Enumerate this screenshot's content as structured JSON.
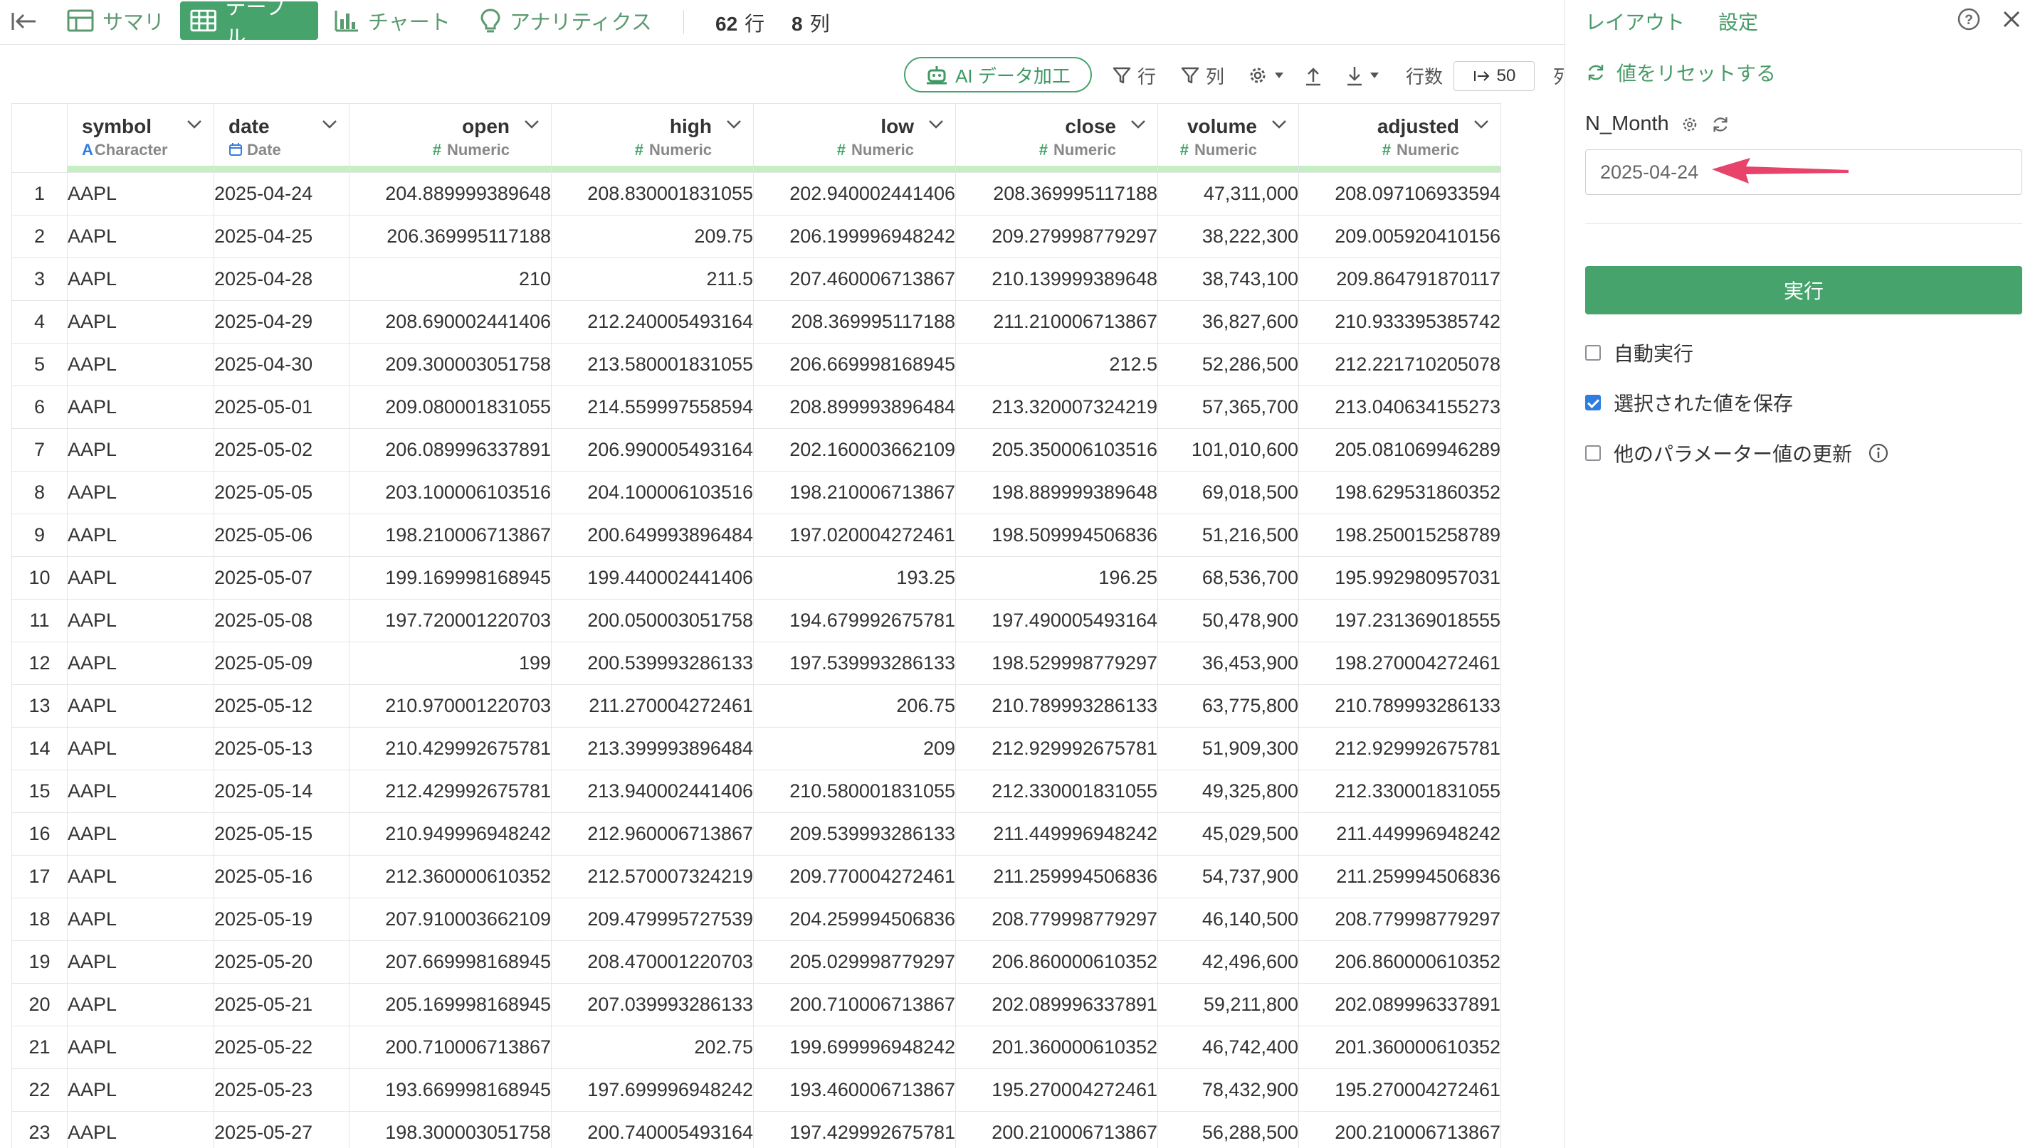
{
  "topbar": {
    "tabs": [
      {
        "label": "サマリ",
        "icon": "summary-grid-icon"
      },
      {
        "label": "テーブル",
        "icon": "table-icon",
        "active": true
      },
      {
        "label": "チャート",
        "icon": "bar-chart-icon"
      },
      {
        "label": "アナリティクス",
        "icon": "lightbulb-icon"
      }
    ],
    "rows_count": "62",
    "rows_unit": "行",
    "cols_count": "8",
    "cols_unit": "列"
  },
  "toolbar": {
    "ai_label": "AI データ加工",
    "filter_rows": "行",
    "filter_cols": "列",
    "rows_label": "行数",
    "rows_value": "50",
    "cut_label": "列"
  },
  "table": {
    "columns": [
      {
        "name": "symbol",
        "type": "Character",
        "type_icon": "A",
        "align": "l"
      },
      {
        "name": "date",
        "type": "Date",
        "type_icon": "calendar",
        "align": "l"
      },
      {
        "name": "open",
        "type": "Numeric",
        "type_icon": "#",
        "align": "r"
      },
      {
        "name": "high",
        "type": "Numeric",
        "type_icon": "#",
        "align": "r"
      },
      {
        "name": "low",
        "type": "Numeric",
        "type_icon": "#",
        "align": "r"
      },
      {
        "name": "close",
        "type": "Numeric",
        "type_icon": "#",
        "align": "r"
      },
      {
        "name": "volume",
        "type": "Numeric",
        "type_icon": "#",
        "align": "r"
      },
      {
        "name": "adjusted",
        "type": "Numeric",
        "type_icon": "#",
        "align": "r"
      }
    ],
    "rows": [
      [
        "1",
        "AAPL",
        "2025-04-24",
        "204.889999389648",
        "208.830001831055",
        "202.940002441406",
        "208.369995117188",
        "47,311,000",
        "208.097106933594"
      ],
      [
        "2",
        "AAPL",
        "2025-04-25",
        "206.369995117188",
        "209.75",
        "206.199996948242",
        "209.279998779297",
        "38,222,300",
        "209.005920410156"
      ],
      [
        "3",
        "AAPL",
        "2025-04-28",
        "210",
        "211.5",
        "207.460006713867",
        "210.139999389648",
        "38,743,100",
        "209.864791870117"
      ],
      [
        "4",
        "AAPL",
        "2025-04-29",
        "208.690002441406",
        "212.240005493164",
        "208.369995117188",
        "211.210006713867",
        "36,827,600",
        "210.933395385742"
      ],
      [
        "5",
        "AAPL",
        "2025-04-30",
        "209.300003051758",
        "213.580001831055",
        "206.669998168945",
        "212.5",
        "52,286,500",
        "212.221710205078"
      ],
      [
        "6",
        "AAPL",
        "2025-05-01",
        "209.080001831055",
        "214.559997558594",
        "208.899993896484",
        "213.320007324219",
        "57,365,700",
        "213.040634155273"
      ],
      [
        "7",
        "AAPL",
        "2025-05-02",
        "206.089996337891",
        "206.990005493164",
        "202.160003662109",
        "205.350006103516",
        "101,010,600",
        "205.081069946289"
      ],
      [
        "8",
        "AAPL",
        "2025-05-05",
        "203.100006103516",
        "204.100006103516",
        "198.210006713867",
        "198.889999389648",
        "69,018,500",
        "198.629531860352"
      ],
      [
        "9",
        "AAPL",
        "2025-05-06",
        "198.210006713867",
        "200.649993896484",
        "197.020004272461",
        "198.509994506836",
        "51,216,500",
        "198.250015258789"
      ],
      [
        "10",
        "AAPL",
        "2025-05-07",
        "199.169998168945",
        "199.440002441406",
        "193.25",
        "196.25",
        "68,536,700",
        "195.992980957031"
      ],
      [
        "11",
        "AAPL",
        "2025-05-08",
        "197.720001220703",
        "200.050003051758",
        "194.679992675781",
        "197.490005493164",
        "50,478,900",
        "197.231369018555"
      ],
      [
        "12",
        "AAPL",
        "2025-05-09",
        "199",
        "200.539993286133",
        "197.539993286133",
        "198.529998779297",
        "36,453,900",
        "198.270004272461"
      ],
      [
        "13",
        "AAPL",
        "2025-05-12",
        "210.970001220703",
        "211.270004272461",
        "206.75",
        "210.789993286133",
        "63,775,800",
        "210.789993286133"
      ],
      [
        "14",
        "AAPL",
        "2025-05-13",
        "210.429992675781",
        "213.399993896484",
        "209",
        "212.929992675781",
        "51,909,300",
        "212.929992675781"
      ],
      [
        "15",
        "AAPL",
        "2025-05-14",
        "212.429992675781",
        "213.940002441406",
        "210.580001831055",
        "212.330001831055",
        "49,325,800",
        "212.330001831055"
      ],
      [
        "16",
        "AAPL",
        "2025-05-15",
        "210.949996948242",
        "212.960006713867",
        "209.539993286133",
        "211.449996948242",
        "45,029,500",
        "211.449996948242"
      ],
      [
        "17",
        "AAPL",
        "2025-05-16",
        "212.360000610352",
        "212.570007324219",
        "209.770004272461",
        "211.259994506836",
        "54,737,900",
        "211.259994506836"
      ],
      [
        "18",
        "AAPL",
        "2025-05-19",
        "207.910003662109",
        "209.479995727539",
        "204.259994506836",
        "208.779998779297",
        "46,140,500",
        "208.779998779297"
      ],
      [
        "19",
        "AAPL",
        "2025-05-20",
        "207.669998168945",
        "208.470001220703",
        "205.029998779297",
        "206.860000610352",
        "42,496,600",
        "206.860000610352"
      ],
      [
        "20",
        "AAPL",
        "2025-05-21",
        "205.169998168945",
        "207.039993286133",
        "200.710006713867",
        "202.089996337891",
        "59,211,800",
        "202.089996337891"
      ],
      [
        "21",
        "AAPL",
        "2025-05-22",
        "200.710006713867",
        "202.75",
        "199.699996948242",
        "201.360000610352",
        "46,742,400",
        "201.360000610352"
      ],
      [
        "22",
        "AAPL",
        "2025-05-23",
        "193.669998168945",
        "197.699996948242",
        "193.460006713867",
        "195.270004272461",
        "78,432,900",
        "195.270004272461"
      ],
      [
        "23",
        "AAPL",
        "2025-05-27",
        "198.300003051758",
        "200.740005493164",
        "197.429992675781",
        "200.210006713867",
        "56,288,500",
        "200.210006713867"
      ]
    ]
  },
  "panel": {
    "tab_layout": "レイアウト",
    "tab_settings": "設定",
    "reset_label": "値をリセットする",
    "param_name": "N_Month",
    "param_value": "2025-04-24",
    "run_label": "実行",
    "options": [
      {
        "label": "自動実行",
        "checked": false
      },
      {
        "label": "選択された値を保存",
        "checked": true
      },
      {
        "label": "他のパラメーター値の更新",
        "checked": false,
        "info": true
      }
    ]
  },
  "colors": {
    "accent": "#45a36b",
    "annotation_arrow": "#e8436a",
    "checkbox": "#2f7de1"
  }
}
